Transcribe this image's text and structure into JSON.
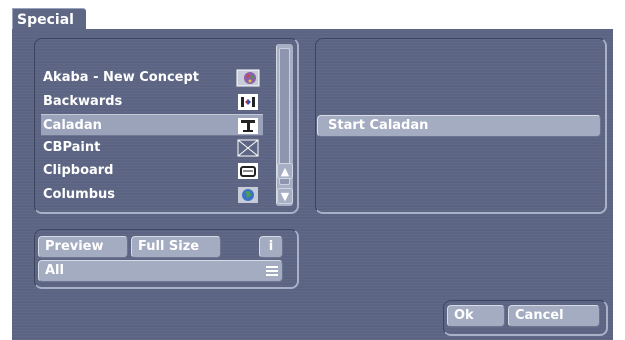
{
  "window": {
    "tab_title": "Special"
  },
  "list": {
    "items": [
      {
        "label": "Akaba - New Concept",
        "icon": "paint-palette-icon",
        "glyph": "🎨",
        "selected": false
      },
      {
        "label": "Backwards",
        "icon": "reverse-arrows-icon",
        "glyph": "⇆",
        "selected": false
      },
      {
        "label": "Caladan",
        "icon": "table-icon",
        "glyph": "⊤",
        "selected": true
      },
      {
        "label": "CBPaint",
        "icon": "crossed-box-icon",
        "glyph": "☒",
        "selected": false
      },
      {
        "label": "Clipboard",
        "icon": "clipboard-icon",
        "glyph": "▤",
        "selected": false
      },
      {
        "label": "Columbus",
        "icon": "globe-icon",
        "glyph": "🌍",
        "selected": false
      }
    ],
    "scroll_up_glyph": "▲",
    "scroll_down_glyph": "▼"
  },
  "bottom": {
    "preview_label": "Preview",
    "full_size_label": "Full Size",
    "info_label": "i",
    "filter_value": "All"
  },
  "right": {
    "start_label": "Start Caladan"
  },
  "dialog": {
    "ok_label": "Ok",
    "cancel_label": "Cancel"
  },
  "colors": {
    "background": "#5b6482",
    "button": "#a4acc1",
    "selection": "#9aa3b9",
    "text": "#ffffff"
  }
}
